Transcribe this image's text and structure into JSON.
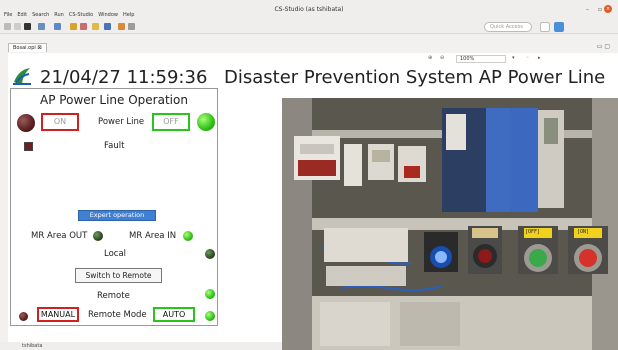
{
  "window": {
    "title": "CS-Studio (as tshibata)",
    "controls": [
      "–",
      "×"
    ]
  },
  "menu": [
    "File",
    "Edit",
    "Search",
    "Run",
    "CS-Studio",
    "Window",
    "Help"
  ],
  "toolbar": {
    "quick_access_placeholder": "Quick Access"
  },
  "editor_tab": {
    "label": "Bosai.opi ⊠"
  },
  "zoom": {
    "value": "100%"
  },
  "header": {
    "datetime": "21/04/27 11:59:36",
    "system_title": "Disaster Prevention System  AP Power Line"
  },
  "panel": {
    "title": "AP Power Line Operation",
    "on_label": "ON",
    "power_line_label": "Power Line",
    "off_label": "OFF",
    "fault_label": "Fault",
    "expert_button": "Expert operation",
    "mr_area_out": "MR Area OUT",
    "mr_area_in": "MR Area IN",
    "local_label": "Local",
    "switch_button": "Switch to Remote",
    "remote_label": "Remote",
    "manual_label": "MANUAL",
    "remote_mode_label": "Remote Mode",
    "auto_label": "AUTO"
  },
  "photo": {
    "off_tag": "[OFF]",
    "on_tag": "[ON]"
  },
  "status": {
    "user": "tshibata"
  },
  "colors": {
    "accent_blue": "#3f7fd4",
    "led_green": "#2fbf16",
    "alarm_red": "#d41f1f",
    "ok_green": "#2bc41c"
  }
}
